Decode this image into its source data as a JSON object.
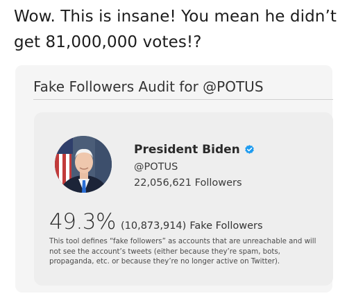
{
  "caption": "Wow. This is insane! You mean he didn’t get 81,000,000 votes!?",
  "audit": {
    "title": "Fake Followers Audit for @POTUS"
  },
  "profile": {
    "name": "President Biden",
    "verified_icon": "verified-badge-icon",
    "verified_color": "#1d9bf0",
    "handle": "@POTUS",
    "followers_count": "22,056,621",
    "followers_label": "Followers",
    "avatar_icon": "profile-photo"
  },
  "result": {
    "fake_percent": "49.3%",
    "fake_count": "(10,873,914)",
    "fake_label": "Fake Followers",
    "definition": "This tool defines “fake followers” as accounts that are unreachable and will not see the account’s tweets (either because they’re spam, bots, propaganda, etc. or because they’re no longer active on Twitter)."
  }
}
